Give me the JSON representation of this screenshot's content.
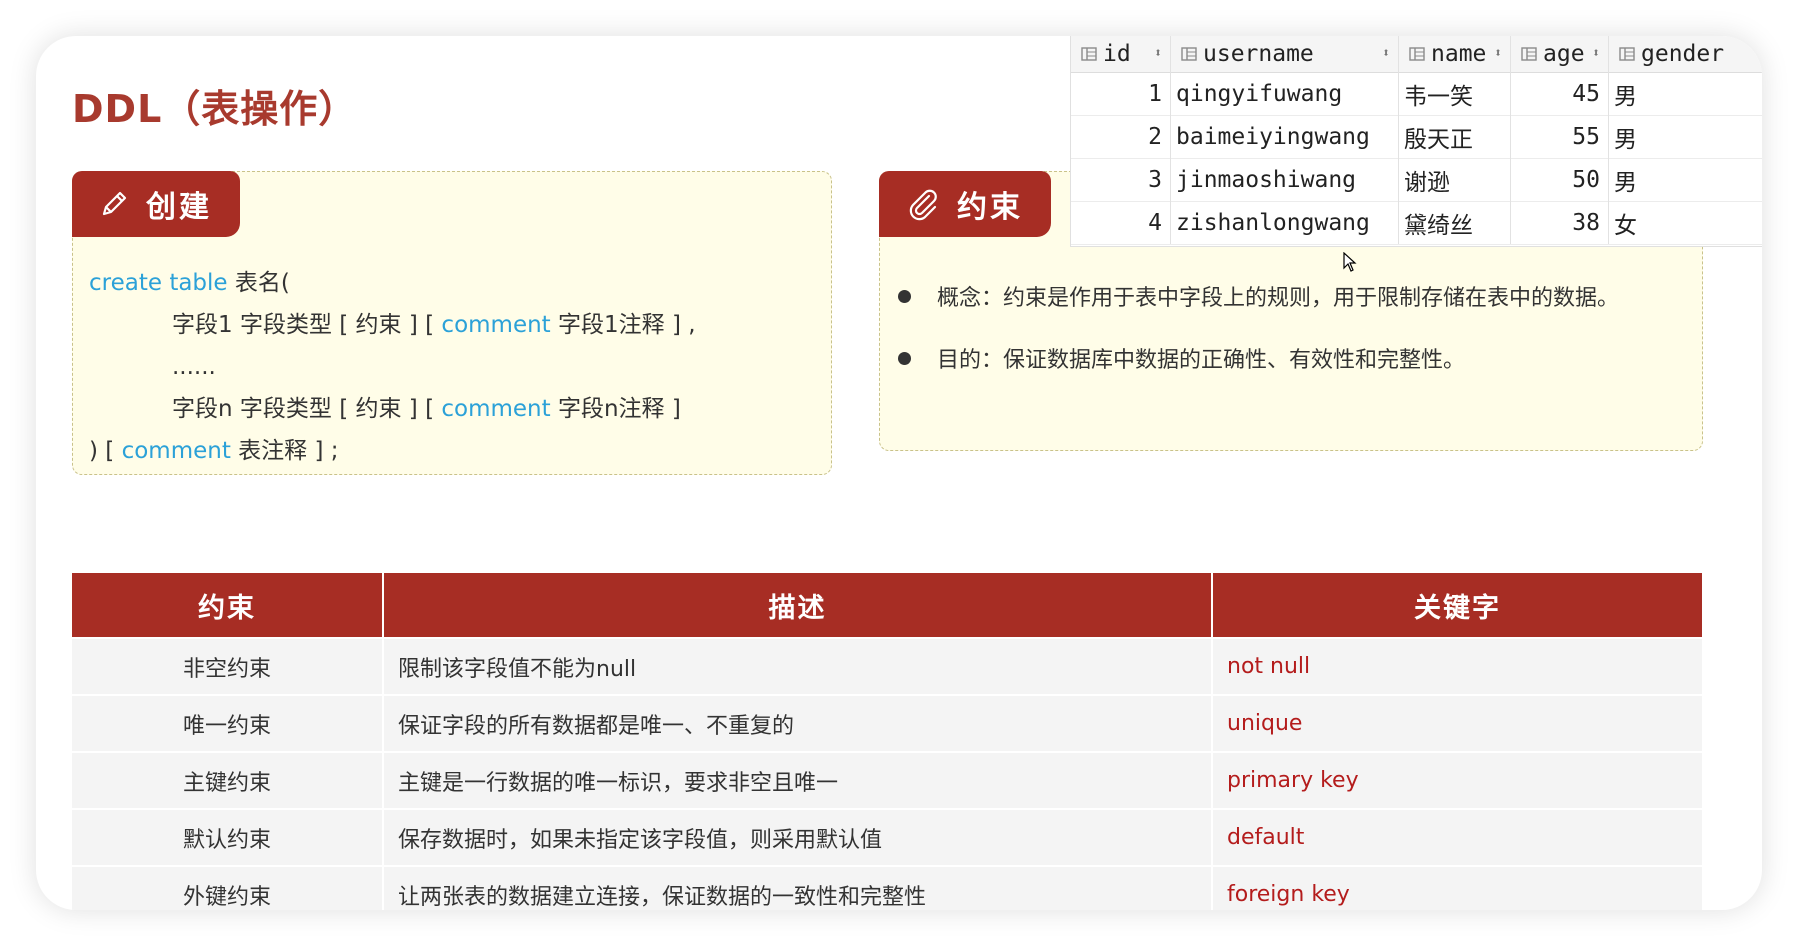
{
  "page": {
    "title": "DDL（表操作）"
  },
  "create_card": {
    "tag_label": "创建",
    "lines": [
      {
        "kw": "create table",
        "text": " 表名("
      },
      {
        "pre": "字段1  字段类型 [ 约束 ] [ ",
        "kw": "comment",
        "post": " 字段1注释 ] ,"
      },
      {
        "pre": "......"
      },
      {
        "pre": "字段n  字段类型 [ 约束 ] [ ",
        "kw": "comment",
        "post": " 字段n注释 ]"
      },
      {
        "pre": ") [ ",
        "kw": "comment",
        "post": " 表注释 ] ;"
      }
    ]
  },
  "constraint_card": {
    "tag_label": "约束",
    "bullets": [
      "概念：约束是作用于表中字段上的规则，用于限制存储在表中的数据。",
      "目的：保证数据库中数据的正确性、有效性和完整性。"
    ]
  },
  "result_table": {
    "columns": [
      "id",
      "username",
      "name",
      "age",
      "gender"
    ],
    "rows": [
      {
        "id": "1",
        "username": "qingyifuwang",
        "name": "韦一笑",
        "age": "45",
        "gender": "男"
      },
      {
        "id": "2",
        "username": "baimeiyingwang",
        "name": "殷天正",
        "age": "55",
        "gender": "男"
      },
      {
        "id": "3",
        "username": "jinmaoshiwang",
        "name": "谢逊",
        "age": "50",
        "gender": "男"
      },
      {
        "id": "4",
        "username": "zishanlongwang",
        "name": "黛绮丝",
        "age": "38",
        "gender": "女"
      }
    ]
  },
  "constraint_table": {
    "headers": [
      "约束",
      "描述",
      "关键字"
    ],
    "rows": [
      {
        "name": "非空约束",
        "desc": "限制该字段值不能为null",
        "key": "not  null"
      },
      {
        "name": "唯一约束",
        "desc": "保证字段的所有数据都是唯一、不重复的",
        "key": "unique"
      },
      {
        "name": "主键约束",
        "desc": "主键是一行数据的唯一标识，要求非空且唯一",
        "key": "primary  key"
      },
      {
        "name": "默认约束",
        "desc": "保存数据时，如果未指定该字段值，则采用默认值",
        "key": "default"
      },
      {
        "name": "外键约束",
        "desc": "让两张表的数据建立连接，保证数据的一致性和完整性",
        "key": "foreign  key"
      }
    ]
  },
  "colors": {
    "accent": "#a72d24",
    "title": "#a83a2e",
    "keyword_blue": "#2ba1d8",
    "keyword_red": "#b41c1c",
    "card_bg": "#fffde8"
  }
}
